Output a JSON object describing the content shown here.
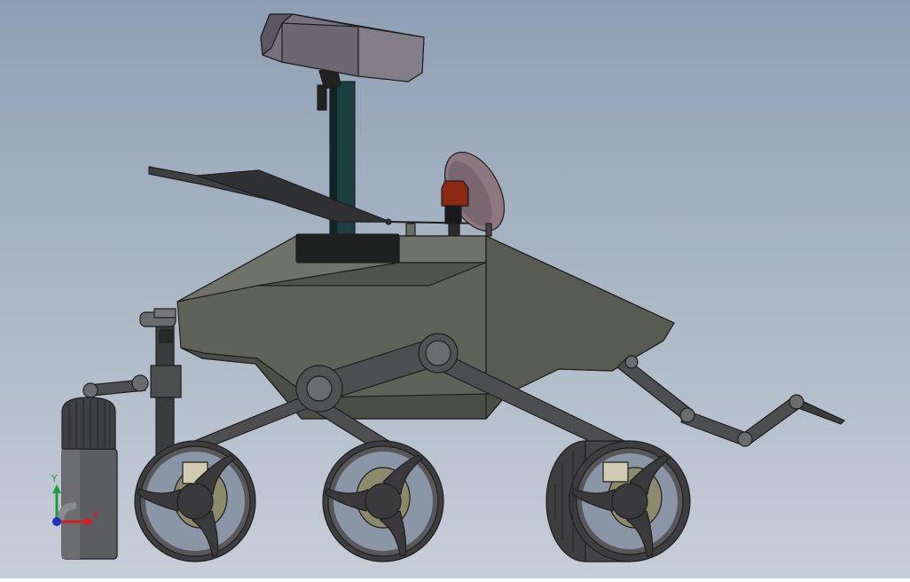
{
  "viewport": {
    "background_top": "#8f9fb3",
    "background_bottom": "#c6ced8"
  },
  "triad": {
    "x_label": "X",
    "y_label": "Y",
    "x_color": "#d42020",
    "y_color": "#1f9a3a",
    "z_color": "#2030c0"
  },
  "colors": {
    "body": "#5f6259",
    "body_dark": "#4b4e46",
    "body_light": "#6f7269",
    "mast": "#1c3f40",
    "camera": "#77727d",
    "dish": "#8e7880",
    "beacon": "#8a2a12",
    "wheel": "#4a4a4c",
    "hub": "#8c8a6c",
    "arm": "#4c4e50",
    "solar_panel": "#3e4042",
    "canister": "#5b5d60"
  }
}
